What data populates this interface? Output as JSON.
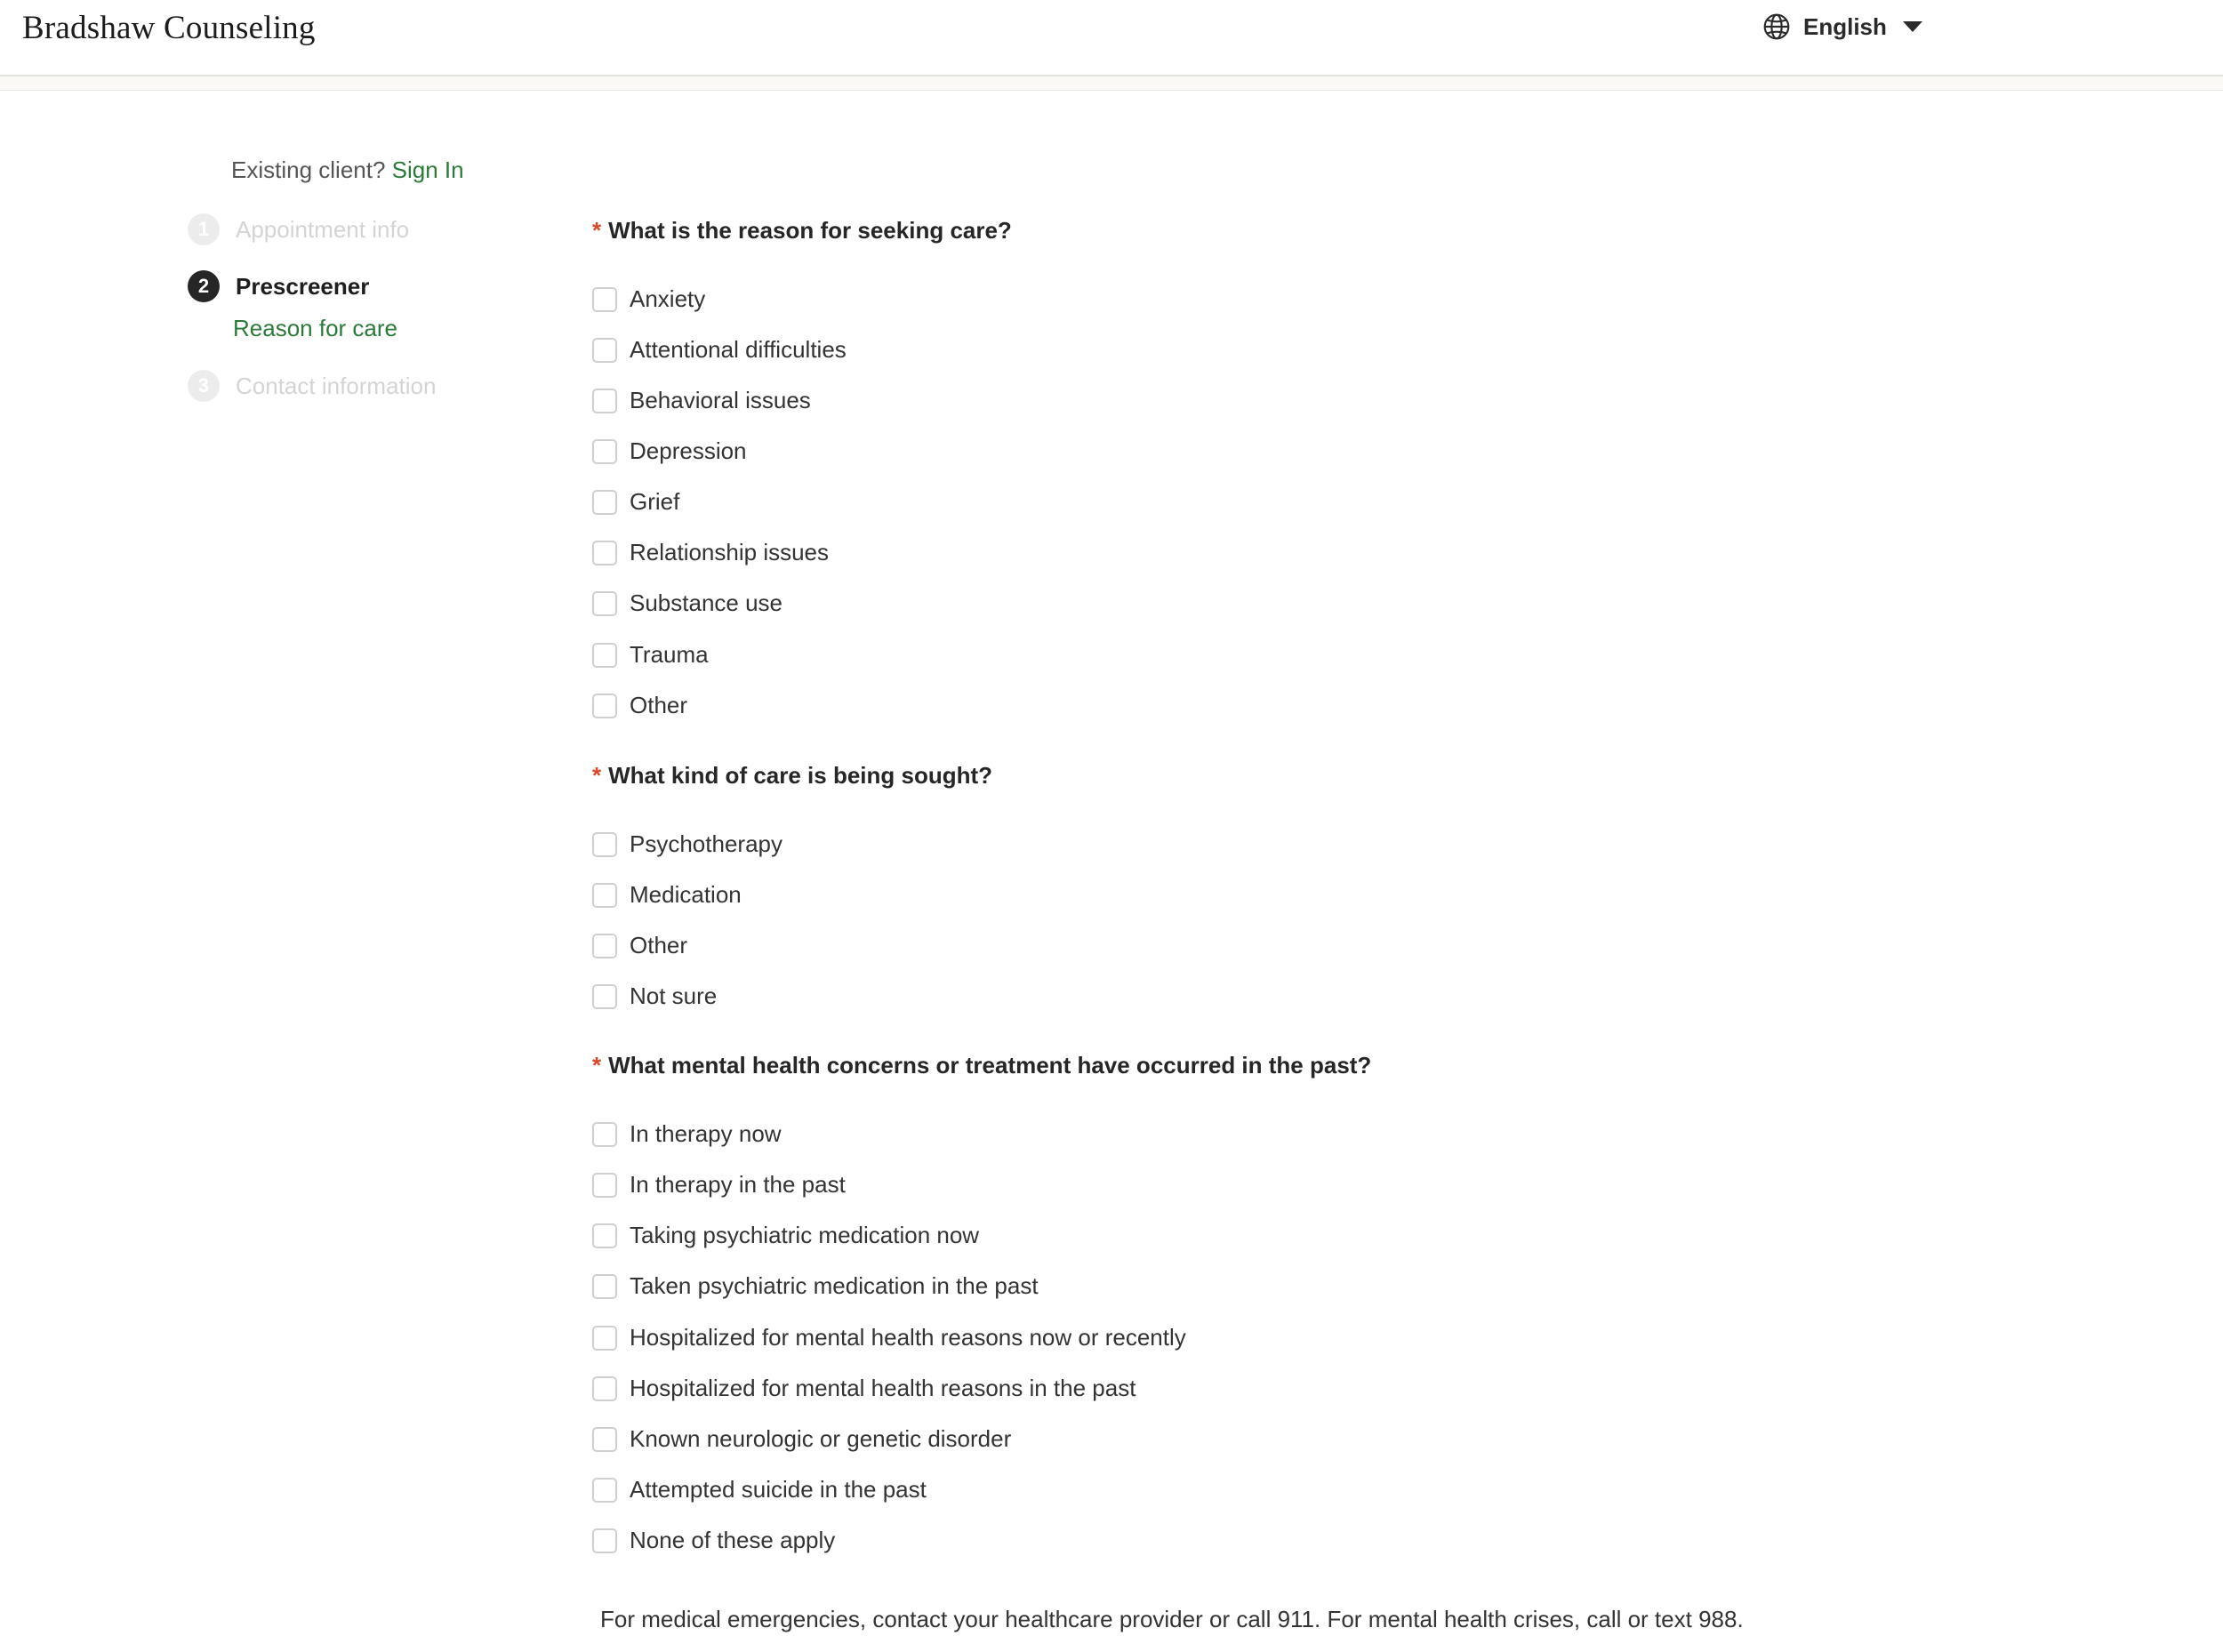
{
  "header": {
    "brand": "Bradshaw Counseling",
    "language": "English",
    "globe_icon": "globe-icon",
    "caret_icon": "caret-down-icon"
  },
  "sidebar": {
    "existing_prefix": "Existing client?",
    "sign_in": "Sign In",
    "steps": [
      {
        "num": "1",
        "label": "Appointment info",
        "state": "inactive"
      },
      {
        "num": "2",
        "label": "Prescreener",
        "state": "active"
      },
      {
        "num": "3",
        "label": "Contact information",
        "state": "inactive"
      }
    ],
    "current_substep": "Reason for care"
  },
  "form": {
    "required_marker": "*",
    "questions": [
      {
        "label": "What is the reason for seeking care?",
        "options": [
          "Anxiety",
          "Attentional difficulties",
          "Behavioral issues",
          "Depression",
          "Grief",
          "Relationship issues",
          "Substance use",
          "Trauma",
          "Other"
        ]
      },
      {
        "label": "What kind of care is being sought?",
        "options": [
          "Psychotherapy",
          "Medication",
          "Other",
          "Not sure"
        ]
      },
      {
        "label": "What mental health concerns or treatment have occurred in the past?",
        "options": [
          "In therapy now",
          "In therapy in the past",
          "Taking psychiatric medication now",
          "Taken psychiatric medication in the past",
          "Hospitalized for mental health reasons now or recently",
          "Hospitalized for mental health reasons in the past",
          "Known neurologic or genetic disorder",
          "Attempted suicide in the past",
          "None of these apply"
        ]
      }
    ]
  },
  "footer": {
    "note": "For medical emergencies, contact your healthcare provider or call 911. For mental health crises, call or text 988."
  },
  "colors": {
    "accent_green": "#2b7a3a",
    "required_red": "#d9472b",
    "active_step": "#262626"
  }
}
